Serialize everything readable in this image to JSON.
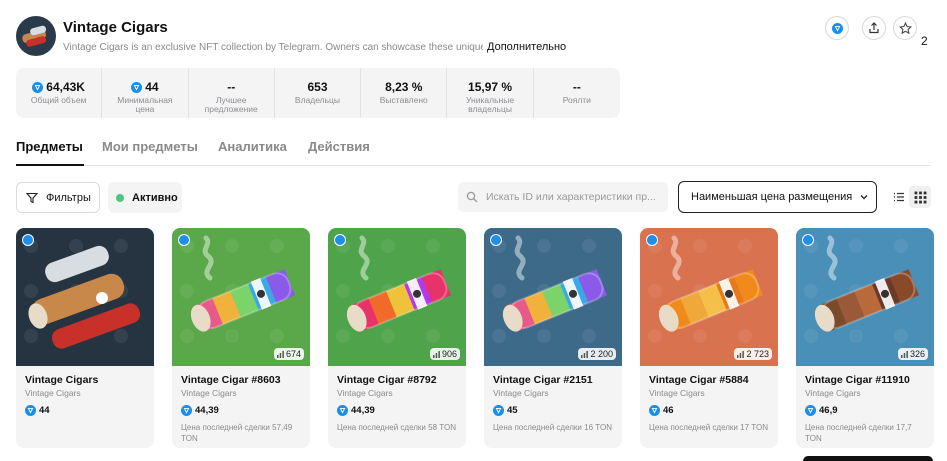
{
  "header": {
    "title": "Vintage Cigars",
    "description": "Vintage Cigars is an exclusive NFT collection by Telegram. Owners can showcase these unique NFTs in t",
    "more_label": "Дополнительно",
    "favorites_count": "2"
  },
  "stats": [
    {
      "value": "64,43K",
      "label": "Общий объем",
      "ton": true
    },
    {
      "value": "44",
      "label": "Минимальная цена",
      "ton": true
    },
    {
      "value": "--",
      "label": "Лучшее предложение",
      "ton": false
    },
    {
      "value": "653",
      "label": "Владельцы",
      "ton": false
    },
    {
      "value": "8,23 %",
      "label": "Выставлено",
      "ton": false
    },
    {
      "value": "15,97 %",
      "label": "Уникальные владельцы",
      "ton": false
    },
    {
      "value": "--",
      "label": "Роялти",
      "ton": false
    }
  ],
  "tabs": [
    {
      "label": "Предметы",
      "active": true
    },
    {
      "label": "Мои предметы",
      "active": false
    },
    {
      "label": "Аналитика",
      "active": false
    },
    {
      "label": "Действия",
      "active": false
    }
  ],
  "toolbar": {
    "filters_label": "Фильтры",
    "active_label": "Активно",
    "search_placeholder": "Искать ID или характеристики пр...",
    "sort_label": "Наименьшая цена размещения"
  },
  "cards": [
    {
      "name": "Vintage Cigars",
      "collection": "Vintage Cigars",
      "price": "44",
      "count": "",
      "last_sale": "",
      "bg": "#263441",
      "cigar": "multi"
    },
    {
      "name": "Vintage Cigar #8603",
      "collection": "Vintage Cigars",
      "price": "44,39",
      "count": "674",
      "last_sale": "Цена последней сделки 57,49 TON",
      "bg": "#5aa84a",
      "cigar": "rainbow"
    },
    {
      "name": "Vintage Cigar #8792",
      "collection": "Vintage Cigars",
      "price": "44,39",
      "count": "906",
      "last_sale": "Цена последней сделки 58 TON",
      "bg": "#4fa34a",
      "cigar": "sunset"
    },
    {
      "name": "Vintage Cigar #2151",
      "collection": "Vintage Cigars",
      "price": "45",
      "count": "2 200",
      "last_sale": "Цена последней сделки 16 TON",
      "bg": "#3e6a8a",
      "cigar": "rainbow"
    },
    {
      "name": "Vintage Cigar #5884",
      "collection": "Vintage Cigars",
      "price": "46",
      "count": "2 723",
      "last_sale": "Цена последней сделки 17 TON",
      "bg": "#d9724f",
      "cigar": "orange"
    },
    {
      "name": "Vintage Cigar #11910",
      "collection": "Vintage Cigars",
      "price": "46,9",
      "count": "326",
      "last_sale": "Цена последней сделки 17,7 TON",
      "bg": "#4a8fb8",
      "cigar": "brown"
    }
  ]
}
